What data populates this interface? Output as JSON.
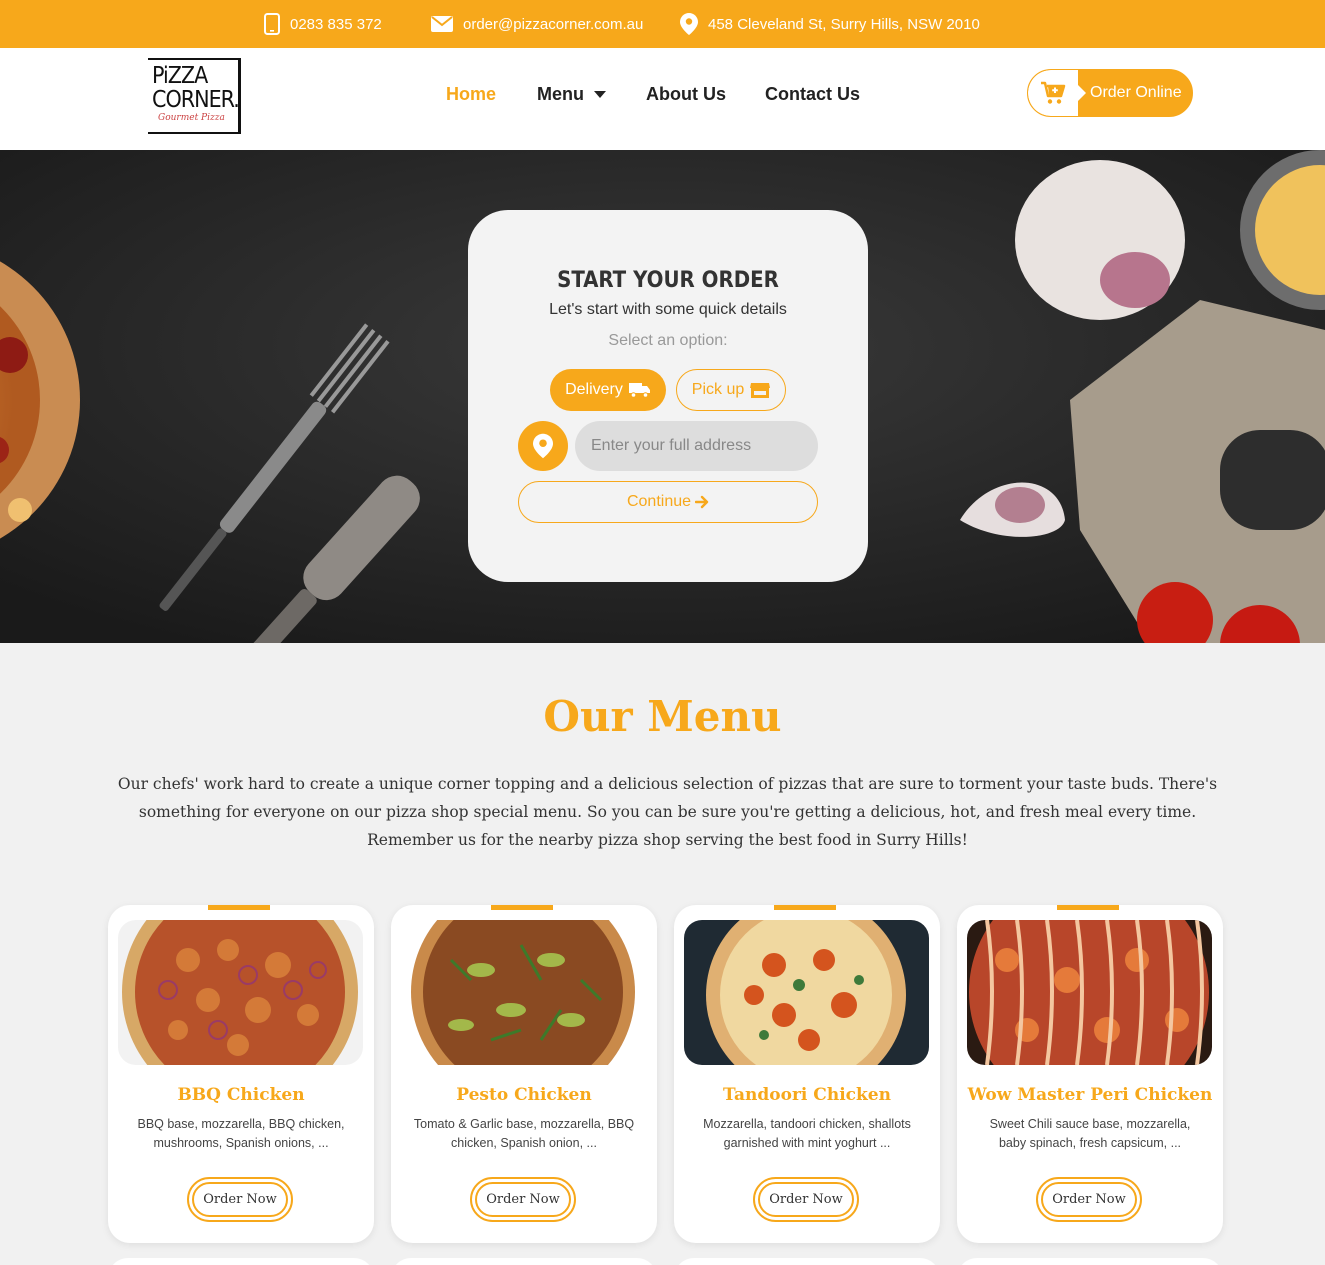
{
  "topbar": {
    "phone": "0283 835 372",
    "email": "order@pizzacorner.com.au",
    "address": "458 Cleveland St, Surry Hills, NSW 2010"
  },
  "logo": {
    "line1": "PiZZA",
    "line2": "CORNER.",
    "line3": "Gourmet Pizza"
  },
  "nav": {
    "home": "Home",
    "menu": "Menu",
    "about": "About Us",
    "contact": "Contact Us",
    "order_online": "Order Online"
  },
  "order_card": {
    "title": "START YOUR ORDER",
    "subtitle": "Let's start with some quick details",
    "select_label": "Select an option:",
    "delivery": "Delivery",
    "pickup": "Pick up",
    "address_placeholder": "Enter your full address",
    "continue": "Continue"
  },
  "menu": {
    "title": "Our Menu",
    "description": "Our chefs' work hard to create a unique corner topping and a delicious selection of pizzas that are sure to torment your taste buds. There's something for everyone on our pizza shop special menu. So you can be sure you're getting a delicious, hot, and fresh meal every time. Remember us for the nearby pizza shop serving the best food in Surry Hills!",
    "items": [
      {
        "name": "BBQ Chicken",
        "desc": "BBQ base, mozzarella, BBQ chicken, mushrooms, Spanish onions, ...",
        "button": "Order Now"
      },
      {
        "name": "Pesto Chicken",
        "desc": "Tomato & Garlic base, mozzarella, BBQ chicken, Spanish onion, ...",
        "button": "Order Now"
      },
      {
        "name": "Tandoori Chicken",
        "desc": "Mozzarella, tandoori chicken, shallots garnished with mint yoghurt ...",
        "button": "Order Now"
      },
      {
        "name": "Wow Master Peri Chicken",
        "desc": "Sweet Chili sauce base, mozzarella, baby spinach, fresh capsicum, ...",
        "button": "Order Now"
      }
    ]
  },
  "colors": {
    "accent": "#f7a81b",
    "page_bg": "#f1f1f1",
    "hero_bg": "#242424"
  }
}
